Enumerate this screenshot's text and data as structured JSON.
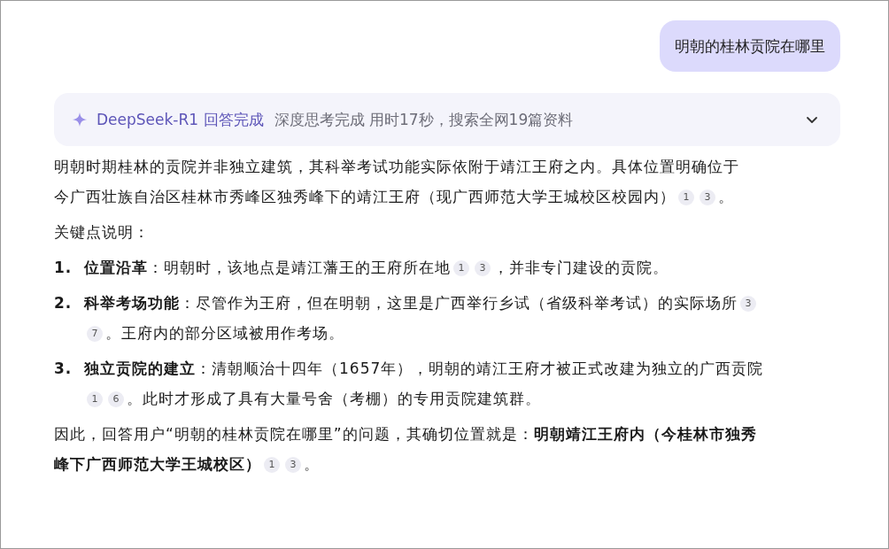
{
  "question": "明朝的桂林贡院在哪里",
  "status": {
    "model": "DeepSeek-R1 回答完成",
    "detail": "深度思考完成 用时17秒，搜索全网19篇资料",
    "expanded": false
  },
  "answer": [
    {
      "kind": "paragraph",
      "lines": [
        [
          {
            "text": "明朝时期桂林的贡院并非独立建筑，其科举考试功能实际依附于靖江王府之内。具体位置明确位于"
          }
        ],
        [
          {
            "text": "今广西壮族自治区桂林市秀峰区独秀峰下的靖江王府（现广西师范大学王城校区校园内）"
          },
          {
            "cite": "1"
          },
          {
            "cite": "3"
          },
          {
            "text": "。"
          }
        ]
      ]
    },
    {
      "kind": "paragraph",
      "lines": [
        [
          {
            "text": "关键点说明："
          }
        ]
      ]
    },
    {
      "kind": "list-item",
      "number": "1.",
      "lines": [
        [
          {
            "text": "**位置沿革**：明朝时，该地点是靖江藩王的王府所在地"
          },
          {
            "cite": "1"
          },
          {
            "cite": "3"
          },
          {
            "text": "，并非专门建设的贡院。"
          }
        ]
      ]
    },
    {
      "kind": "list-item",
      "number": "2.",
      "lines": [
        [
          {
            "text": "**科举考场功能**：尽管作为王府，但在明朝，这里是广西举行乡试（省级科举考试）的实际场所"
          },
          {
            "cite": "3"
          }
        ],
        [
          {
            "cite": "7"
          },
          {
            "text": "。王府内的部分区域被用作考场。"
          }
        ]
      ]
    },
    {
      "kind": "list-item",
      "number": "3.",
      "lines": [
        [
          {
            "text": "**独立贡院的建立**：清朝顺治十四年（1657年），明朝的靖江王府才被正式改建为独立的广西贡院"
          }
        ],
        [
          {
            "cite": "1"
          },
          {
            "cite": "6"
          },
          {
            "text": "。此时才形成了具有大量号舍（考棚）的专用贡院建筑群。"
          }
        ]
      ]
    },
    {
      "kind": "paragraph",
      "lines": [
        [
          {
            "text": "因此，回答用户“明朝的桂林贡院在哪里”的问题，其确切位置就是：**明朝靖江王府内（今桂林市独秀**"
          }
        ],
        [
          {
            "text": "**峰下广西师范大学王城校区）**"
          },
          {
            "cite": "1"
          },
          {
            "cite": "3"
          },
          {
            "text": "。"
          }
        ]
      ]
    }
  ]
}
